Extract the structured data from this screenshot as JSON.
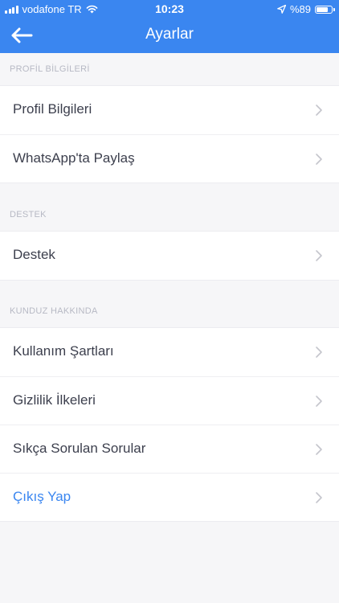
{
  "status_bar": {
    "carrier": "vodafone TR",
    "time": "10:23",
    "battery": "%89",
    "battery_level": 0.89
  },
  "nav": {
    "title": "Ayarlar",
    "back_icon": "arrow-left-icon"
  },
  "sections": [
    {
      "header": "PROFİL BİLGİLERİ",
      "items": [
        {
          "label": "Profil Bilgileri"
        },
        {
          "label": "WhatsApp'ta Paylaş"
        }
      ]
    },
    {
      "header": "DESTEK",
      "items": [
        {
          "label": "Destek"
        }
      ]
    },
    {
      "header": "KUNDUZ HAKKINDA",
      "items": [
        {
          "label": "Kullanım Şartları"
        },
        {
          "label": "Gizlilik İlkeleri"
        },
        {
          "label": "Sıkça Sorulan Sorular"
        },
        {
          "label": "Çıkış Yap"
        }
      ]
    }
  ],
  "colors": {
    "accent": "#3a86f0",
    "background": "#f6f6f8",
    "text": "#3c3f4d",
    "section_header": "#b7b9c4"
  }
}
